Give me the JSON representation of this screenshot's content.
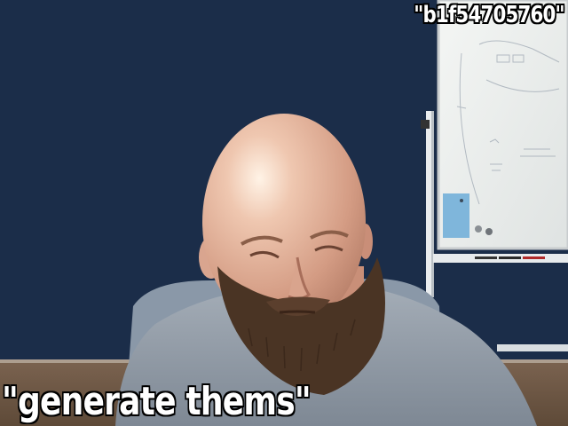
{
  "captions": {
    "top_right": "\"b1f54705760\"",
    "bottom_left": "\"generate thems\""
  },
  "colors": {
    "wall": "#1e3150",
    "floor": "#6b5540",
    "whiteboard": "#eef0ee",
    "shirt": "#8c96a2",
    "skin": "#d9a890",
    "beard": "#4a3424"
  }
}
